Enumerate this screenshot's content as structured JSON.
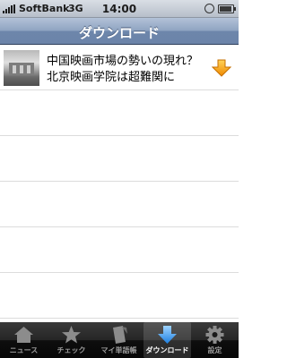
{
  "status": {
    "carrier": "SoftBank",
    "network": "3G",
    "time": "14:00"
  },
  "nav": {
    "title": "ダウンロード"
  },
  "list": {
    "items": [
      {
        "title": "中国映画市場の勢いの現れ？北京映画学院は超難関に"
      }
    ]
  },
  "tabs": [
    {
      "label": "ニュース",
      "icon": "home-icon",
      "active": false
    },
    {
      "label": "チェック",
      "icon": "star-icon",
      "active": false
    },
    {
      "label": "マイ単語帳",
      "icon": "notebook-icon",
      "active": false
    },
    {
      "label": "ダウンロード",
      "icon": "download-arrow-icon",
      "active": true
    },
    {
      "label": "設定",
      "icon": "gear-icon",
      "active": false
    }
  ],
  "colors": {
    "accent": "#f5a000",
    "nav": "#6d86ab",
    "tabbar": "#1a1a1a"
  }
}
